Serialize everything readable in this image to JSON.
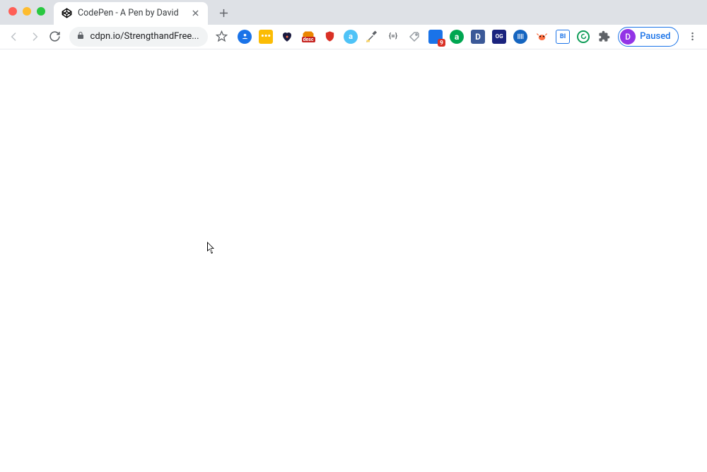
{
  "tab": {
    "title": "CodePen - A Pen by David",
    "favicon": "codepen-icon"
  },
  "address": {
    "url_display": "cdpn.io/StrengthandFree..."
  },
  "profile": {
    "label": "Paused",
    "initial": "D"
  },
  "extensions": [
    {
      "name": "ext-1",
      "bg": "#1a73e8",
      "text": "",
      "shape": "person-badge"
    },
    {
      "name": "ext-2",
      "bg": "#fbbc04",
      "text": "•••",
      "shape": "dots"
    },
    {
      "name": "ext-3",
      "bg": "#000",
      "text": "",
      "shape": "heart"
    },
    {
      "name": "ext-4",
      "bg": "#ea8600",
      "text": "desc",
      "shape": "basket"
    },
    {
      "name": "ext-5",
      "bg": "#d93025",
      "text": "",
      "shape": "shield"
    },
    {
      "name": "ext-6",
      "bg": "#4fc3f7",
      "text": "",
      "shape": "circle-a"
    },
    {
      "name": "ext-7",
      "bg": "#fdd663",
      "text": "",
      "shape": "dropper"
    },
    {
      "name": "ext-8",
      "bg": "#5f6368",
      "text": "{=}",
      "shape": "braces"
    },
    {
      "name": "ext-9",
      "bg": "#fff",
      "text": "",
      "shape": "tag"
    },
    {
      "name": "ext-10",
      "bg": "#1a73e8",
      "text": "",
      "shape": "download",
      "badge": "9"
    },
    {
      "name": "ext-11",
      "bg": "#00a651",
      "text": "a",
      "shape": "circle-letter"
    },
    {
      "name": "ext-12",
      "bg": "#3b5998",
      "text": "D",
      "shape": "square-letter"
    },
    {
      "name": "ext-13",
      "bg": "#1a237e",
      "text": "OG",
      "shape": "square-letter"
    },
    {
      "name": "ext-14",
      "bg": "#1565c0",
      "text": "",
      "shape": "barcode"
    },
    {
      "name": "ext-15",
      "bg": "#ff7043",
      "text": "",
      "shape": "crab"
    },
    {
      "name": "ext-16",
      "bg": "#1a73e8",
      "text": "BI",
      "shape": "square-letter-inv"
    },
    {
      "name": "ext-17",
      "bg": "#0f9d58",
      "text": "",
      "shape": "circle-g"
    }
  ]
}
